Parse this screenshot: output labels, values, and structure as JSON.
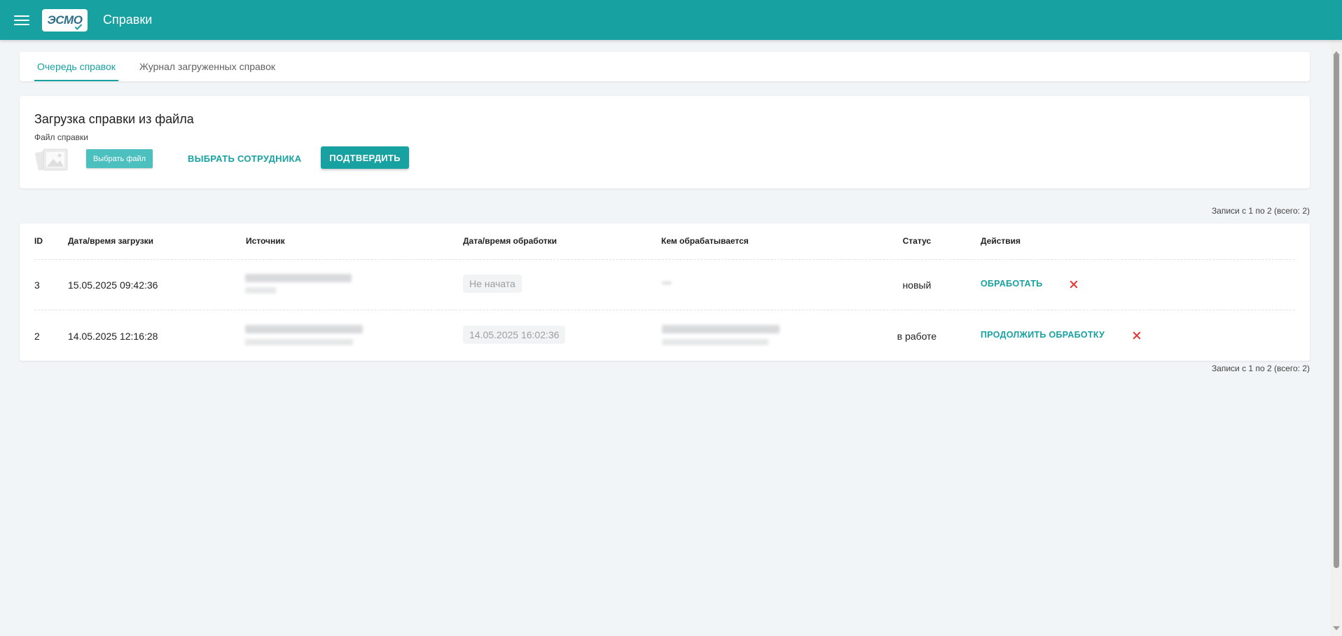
{
  "app": {
    "logo_text": "ЭСМО",
    "title": "Справки"
  },
  "tabs": [
    {
      "label": "Очередь справок",
      "active": true
    },
    {
      "label": "Журнал загруженных справок",
      "active": false
    }
  ],
  "upload": {
    "title": "Загрузка справки из файла",
    "file_label": "Файл справки",
    "choose_file_label": "Выбрать файл",
    "select_employee_label": "ВЫБРАТЬ СОТРУДНИКА",
    "confirm_label": "ПОДТВЕРДИТЬ"
  },
  "records_info": "Записи с 1 по 2 (всего: 2)",
  "table": {
    "columns": [
      "ID",
      "Дата/время загрузки",
      "Источник",
      "Дата/время обработки",
      "Кем обрабатывается",
      "Статус",
      "Действия"
    ],
    "rows": [
      {
        "id": "3",
        "upload_datetime": "15.05.2025 09:42:36",
        "processing_datetime": "Не начата",
        "status": "новый",
        "action_label": "ОБРАБОТАТЬ"
      },
      {
        "id": "2",
        "upload_datetime": "14.05.2025 12:16:28",
        "processing_datetime": "14.05.2025 16:02:36",
        "status": "в работе",
        "action_label": "ПРОДОЛЖИТЬ ОБРАБОТКУ"
      }
    ]
  },
  "colors": {
    "primary": "#17a2a1",
    "background": "#f2f5f7",
    "delete": "#e53935"
  },
  "icons": [
    "menu-icon",
    "image-placeholder-icon",
    "close-icon"
  ]
}
